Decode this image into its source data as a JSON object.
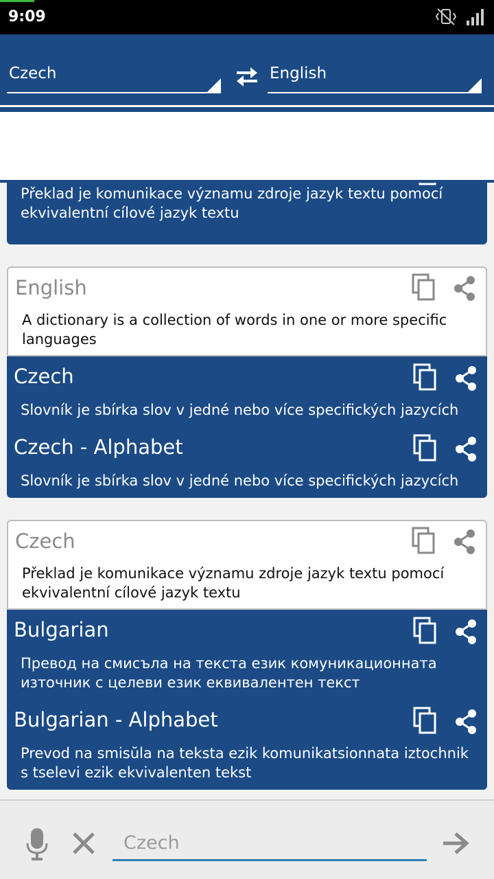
{
  "status": {
    "time": "9:09"
  },
  "toolbar": {
    "source_language": "Czech",
    "target_language": "English"
  },
  "input": {
    "placeholder": "Czech",
    "value": ""
  },
  "cards": [
    {
      "sections": [
        {
          "text": "Překlad je komunikace významu zdroje jazyk textu pomocí ekvivalentní cílové jazyk textu"
        }
      ]
    },
    {
      "sections": [
        {
          "title": "English",
          "text": "A dictionary is a collection of words in one or more specific languages"
        },
        {
          "title": "Czech",
          "text": "Slovník je sbírka slov v jedné nebo více specifických jazycích"
        },
        {
          "title": "Czech - Alphabet",
          "text": "Slovník je sbírka slov v jedné nebo více specifických jazycích"
        }
      ]
    },
    {
      "sections": [
        {
          "title": "Czech",
          "text": "Překlad je komunikace významu zdroje jazyk textu pomocí ekvivalentní cílové jazyk textu"
        },
        {
          "title": "Bulgarian",
          "text": "Превод на смисъла на текста език комуникационната източник с целеви език еквивалентен текст"
        },
        {
          "title": "Bulgarian - Alphabet",
          "text": "Prevod na smisŭla na teksta ezik komunikatsionnata iztochnik s tselevi ezik ekvivalenten tekst"
        }
      ]
    }
  ],
  "icons": {
    "copy": "copy-icon",
    "share": "share-icon",
    "mic": "microphone-icon",
    "clear": "close-icon",
    "send": "arrow-right-icon",
    "swap": "swap-icon"
  },
  "colors": {
    "primary": "#1b4a85",
    "accent": "#2e7fb5"
  }
}
